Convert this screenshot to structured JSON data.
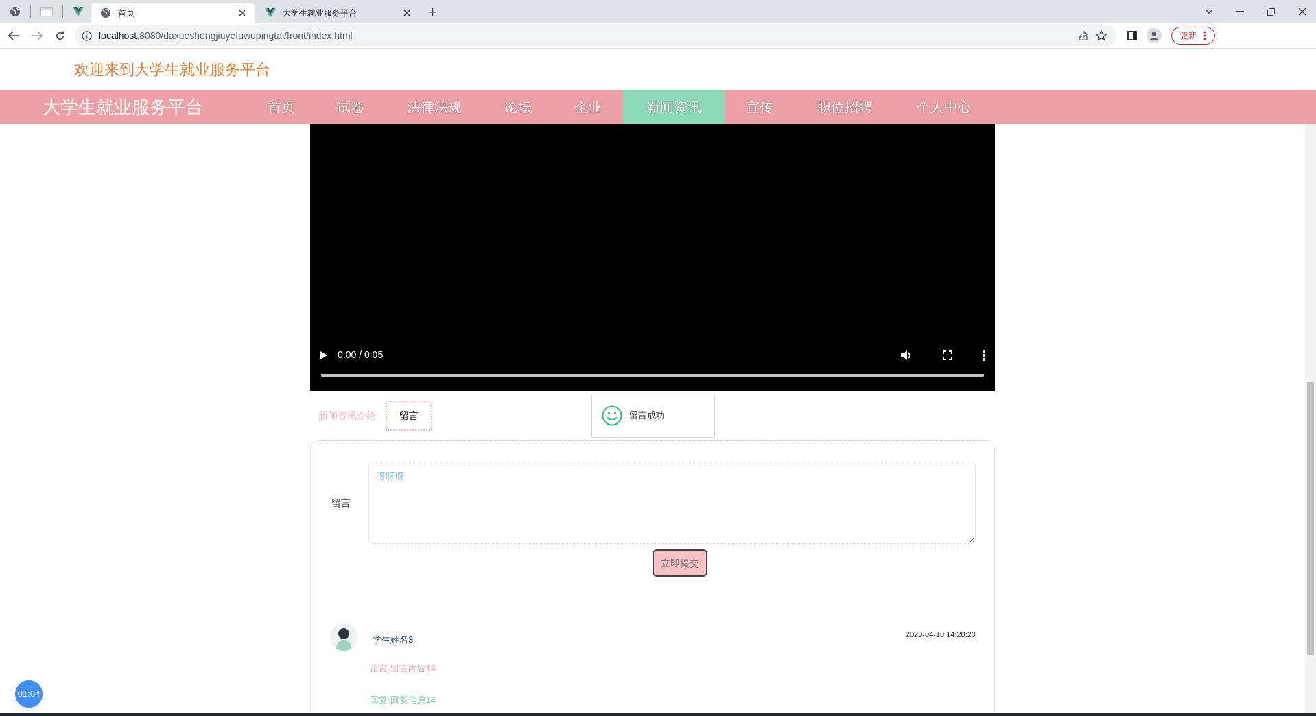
{
  "browser": {
    "tabs": [
      {
        "title": "首页",
        "selected": true,
        "kind": "globe"
      },
      {
        "title": "大学生就业服务平台",
        "selected": false,
        "kind": "vue"
      }
    ],
    "new_tab": "+",
    "url_host": "localhost",
    "url_path": ":8080/daxueshengjiuyefuwupingtai/front/index.html",
    "update_button": "更新"
  },
  "header": {
    "welcome": "欢迎来到大学生就业服务平台"
  },
  "nav": {
    "brand": "大学生就业服务平台",
    "items": [
      {
        "label": "首页",
        "selected": false
      },
      {
        "label": "试卷",
        "selected": false
      },
      {
        "label": "法律法规",
        "selected": false
      },
      {
        "label": "论坛",
        "selected": false
      },
      {
        "label": "企业",
        "selected": false
      },
      {
        "label": "新闻资讯",
        "selected": true
      },
      {
        "label": "宣传",
        "selected": false
      },
      {
        "label": "职位招聘",
        "selected": false
      },
      {
        "label": "个人中心",
        "selected": false
      }
    ]
  },
  "video": {
    "time": "0:00 / 0:05",
    "level": 0
  },
  "tabs": [
    {
      "label": "新闻资讯介绍",
      "selected": false
    },
    {
      "label": "留言",
      "selected": true
    }
  ],
  "toast": {
    "text": "留言成功"
  },
  "form": {
    "label": "留言",
    "value": "呀呀呀",
    "submit": "立即提交"
  },
  "comments": [
    {
      "name": "学生姓名3",
      "time": "2023-04-10 14:28:20",
      "message": "留言:留言内容14",
      "reply": "回复:回复信息14"
    }
  ],
  "timer": "01:04"
}
